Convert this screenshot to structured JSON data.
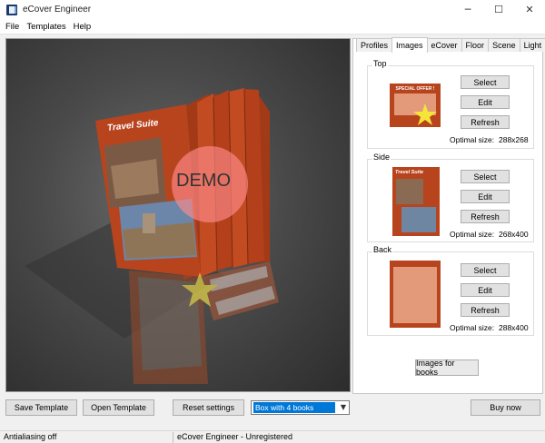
{
  "window": {
    "title": "eCover Engineer",
    "minimize_glyph": "─",
    "maximize_glyph": "☐",
    "close_glyph": "✕"
  },
  "menu": [
    "File",
    "Templates",
    "Help"
  ],
  "viewport": {
    "demo_label": "DEMO",
    "cover_title": "Travel Suite",
    "colors": {
      "cover": "#b8441d",
      "cover_dark": "#8c2f12",
      "floor": "#3d3d3d",
      "demo_circle": "#ff8a8a"
    }
  },
  "tabs": [
    "Profiles",
    "Images",
    "eCover",
    "Floor",
    "Scene",
    "Light"
  ],
  "active_tab": "Images",
  "images": {
    "top": {
      "label": "Top",
      "thumb_text": "SPECIAL OFFER !",
      "select": "Select",
      "edit": "Edit",
      "refresh": "Refresh",
      "optimal_label": "Optimal size:",
      "optimal_value": "288x268"
    },
    "side": {
      "label": "Side",
      "thumb_text": "Travel Suite",
      "select": "Select",
      "edit": "Edit",
      "refresh": "Refresh",
      "optimal_label": "Optimal size:",
      "optimal_value": "268x400"
    },
    "back": {
      "label": "Back",
      "select": "Select",
      "edit": "Edit",
      "refresh": "Refresh",
      "optimal_label": "Optimal size:",
      "optimal_value": "288x400"
    },
    "images_for_books": "Images for books"
  },
  "bottom": {
    "save_template": "Save Template",
    "open_template": "Open Template",
    "reset_settings": "Reset settings",
    "profile_select": "Box with 4 books",
    "buy_now": "Buy now"
  },
  "status": {
    "antialiasing": "Antialiasing off",
    "registration": "eCover Engineer - Unregistered"
  }
}
